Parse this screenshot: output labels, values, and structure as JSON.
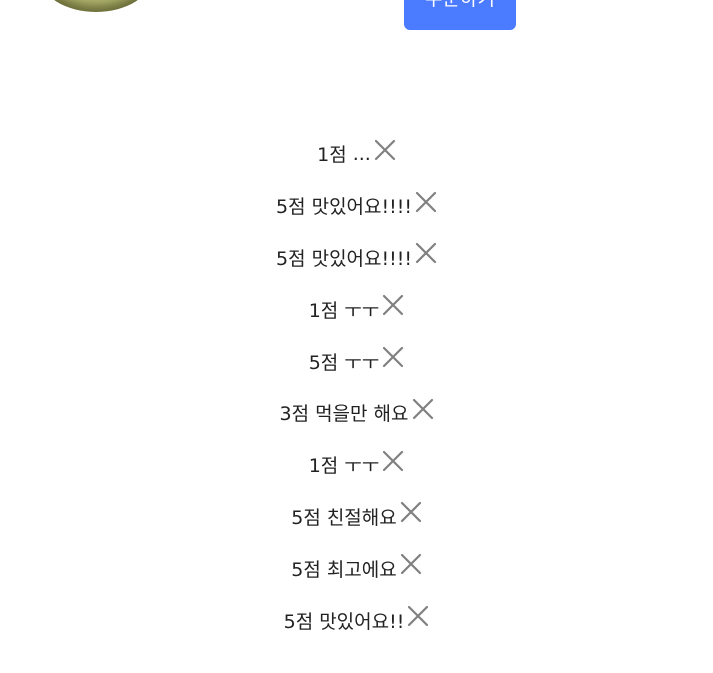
{
  "order_button": {
    "label": "주문하기"
  },
  "reviews": [
    {
      "score": "1점",
      "comment": "..."
    },
    {
      "score": "5점",
      "comment": "맛있어요!!!!"
    },
    {
      "score": "5점",
      "comment": "맛있어요!!!!"
    },
    {
      "score": "1점",
      "comment": "ㅜㅜ"
    },
    {
      "score": "5점",
      "comment": "ㅜㅜ"
    },
    {
      "score": "3점",
      "comment": "먹을만 해요"
    },
    {
      "score": "1점",
      "comment": "ㅜㅜ"
    },
    {
      "score": "5점",
      "comment": "친절해요"
    },
    {
      "score": "5점",
      "comment": "최고에요"
    },
    {
      "score": "5점",
      "comment": "맛있어요!!"
    }
  ],
  "icons": {
    "delete": "close-icon"
  },
  "colors": {
    "accent": "#4b7bff",
    "icon": "#808080",
    "text": "#222222"
  }
}
